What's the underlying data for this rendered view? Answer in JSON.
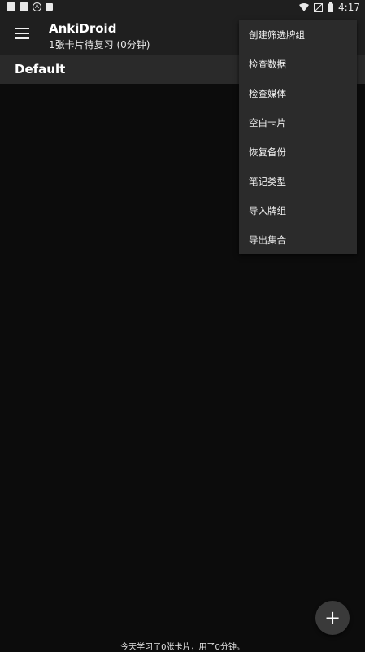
{
  "status_bar": {
    "time": "4:17",
    "left_icons": [
      "notification-icon",
      "notification-icon",
      "anki-icon",
      "notification-icon"
    ],
    "right_icons": [
      "wifi-icon",
      "no-signal-icon",
      "battery-icon"
    ]
  },
  "app_bar": {
    "title": "AnkiDroid",
    "subtitle": "1张卡片待复习 (0分钟)",
    "menu_icon": "hamburger-menu-icon"
  },
  "decks": [
    {
      "name": "Default"
    }
  ],
  "overflow_menu": {
    "items": [
      {
        "label": "创建筛选牌组"
      },
      {
        "label": "检查数据"
      },
      {
        "label": "检查媒体"
      },
      {
        "label": "空白卡片"
      },
      {
        "label": "恢复备份"
      },
      {
        "label": "笔记类型"
      },
      {
        "label": "导入牌组"
      },
      {
        "label": "导出集合"
      }
    ]
  },
  "fab": {
    "icon": "plus-icon",
    "label": "+"
  },
  "footer": {
    "text": "今天学习了0张卡片，用了0分钟。"
  },
  "colors": {
    "background": "#0c0c0c",
    "bar": "#1f1f1f",
    "menu_bg": "#2b2b2b",
    "deck_row": "#2a2a2a"
  }
}
